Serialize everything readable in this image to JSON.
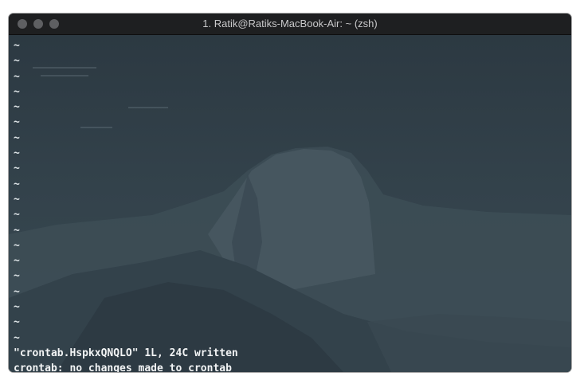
{
  "window": {
    "title": "1. Ratik@Ratiks-MacBook-Air: ~ (zsh)"
  },
  "terminal": {
    "tilde_lines": [
      "~",
      "~",
      "~",
      "~",
      "~",
      "~",
      "~",
      "~",
      "~",
      "~",
      "~",
      "~",
      "~",
      "~",
      "~",
      "~",
      "~",
      "~",
      "~",
      "~"
    ],
    "output": [
      "\"crontab.HspkxQNQLO\" 1L, 24C written",
      "crontab: no changes made to crontab"
    ],
    "prompt": {
      "arrow": "➜",
      "cwd": "~"
    }
  },
  "colors": {
    "titlebar": "#1e1f21",
    "background": "#2f3c45",
    "text": "#f2f4f5"
  }
}
